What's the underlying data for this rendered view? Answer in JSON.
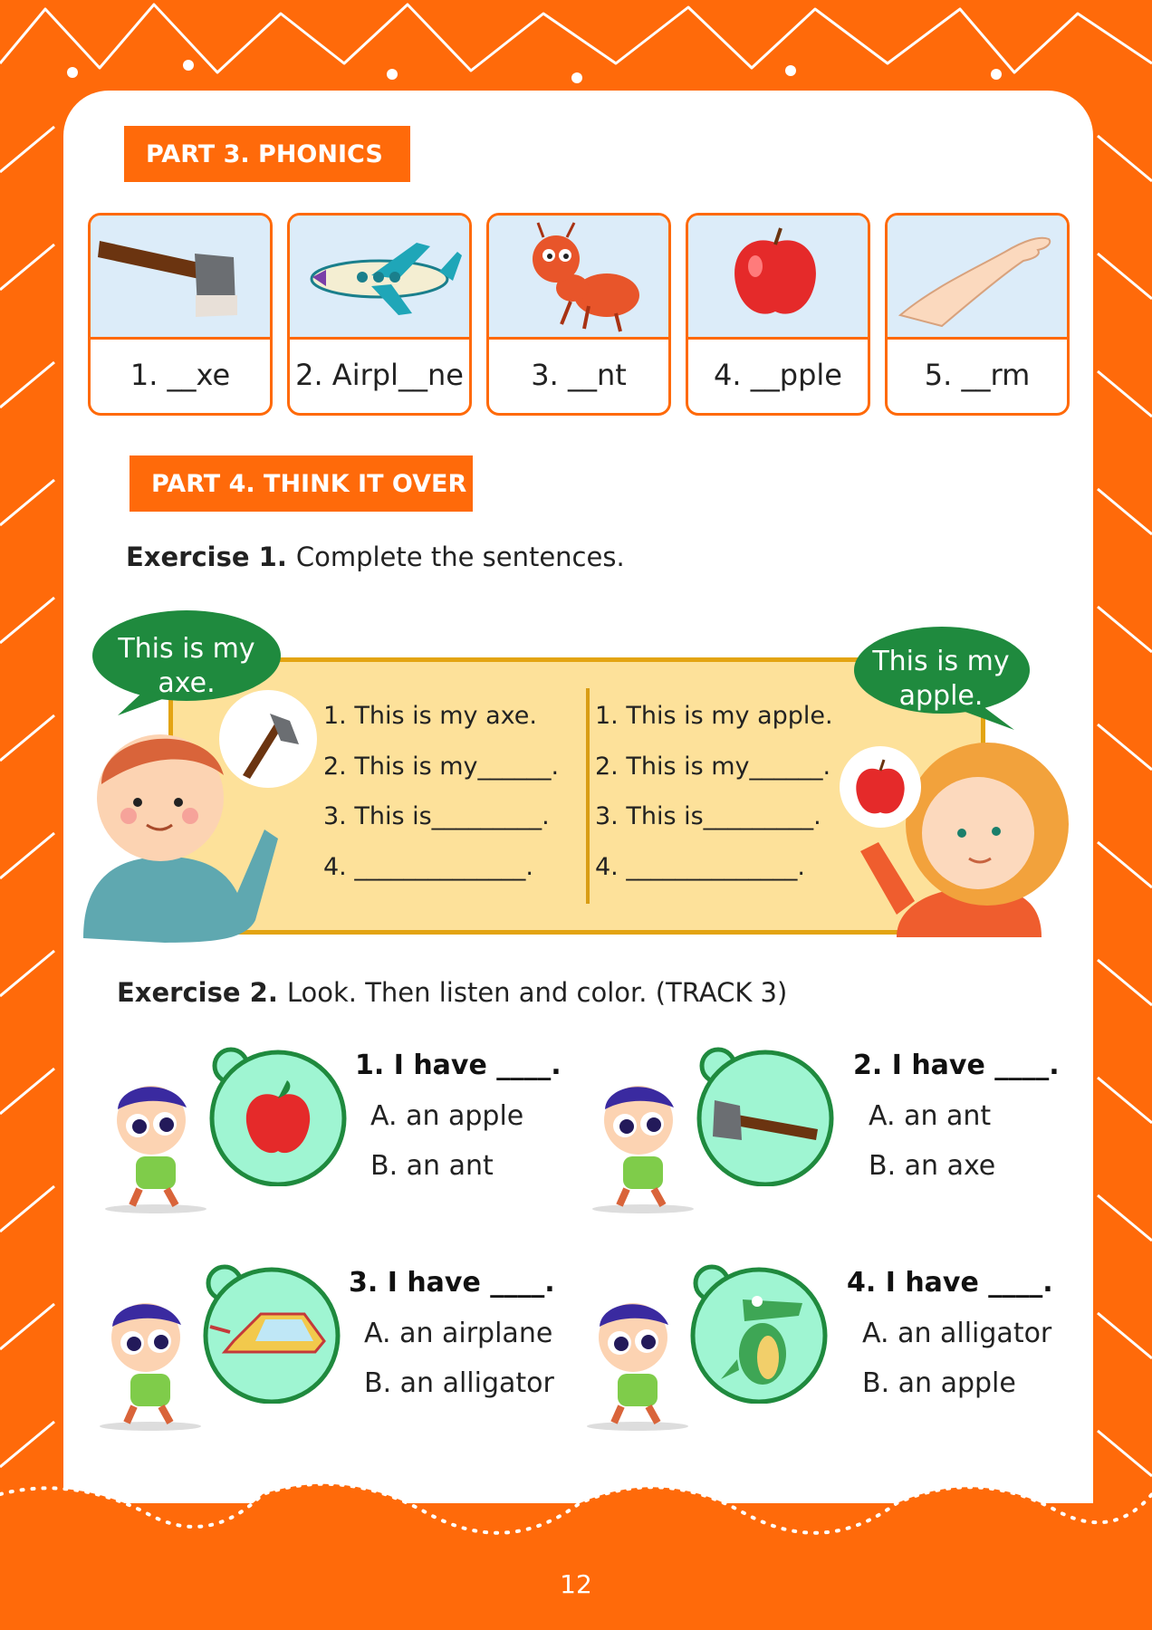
{
  "colors": {
    "orange": "#ff6a0a",
    "green": "#1f8a3e",
    "yellow": "#fde19a",
    "mint": "#9ff5d2",
    "panel_blue": "#dcecf9"
  },
  "part3": {
    "title": "PART 3. PHONICS",
    "cards": [
      {
        "icon": "axe-icon",
        "label": "1. __xe"
      },
      {
        "icon": "airplane-icon",
        "label": "2. Airpl__ne"
      },
      {
        "icon": "ant-icon",
        "label": "3. __nt"
      },
      {
        "icon": "apple-icon",
        "label": "4. __pple"
      },
      {
        "icon": "arm-icon",
        "label": "5. __rm"
      }
    ]
  },
  "part4": {
    "title": "PART 4. THINK IT OVER"
  },
  "exercise1": {
    "label": "Exercise 1.",
    "instruction": "Complete the sentences.",
    "bubble_left": {
      "line1": "This is my",
      "line2": "axe."
    },
    "bubble_right": {
      "line1": "This is my",
      "line2": "apple."
    },
    "left_lines": [
      "1. This is my axe.",
      "2. This is my______.",
      "3. This is_________.",
      "4. ______________."
    ],
    "right_lines": [
      "1. This is my apple.",
      "2. This is my______.",
      "3. This is_________.",
      "4. ______________."
    ]
  },
  "exercise2": {
    "label": "Exercise 2.",
    "instruction": "Look. Then listen and color. (TRACK 3)",
    "questions": [
      {
        "question": "1. I have ____.",
        "a": "A. an apple",
        "b": "B. an ant",
        "icon": "apple-icon"
      },
      {
        "question": "2. I have ____.",
        "a": "A. an ant",
        "b": "B. an axe",
        "icon": "axe-icon"
      },
      {
        "question": "3. I have ____.",
        "a": "A. an airplane",
        "b": "B. an alligator",
        "icon": "airplane-icon"
      },
      {
        "question": "4. I have ____.",
        "a": "A. an alligator",
        "b": "B. an apple",
        "icon": "alligator-icon"
      }
    ]
  },
  "page_number": "12"
}
